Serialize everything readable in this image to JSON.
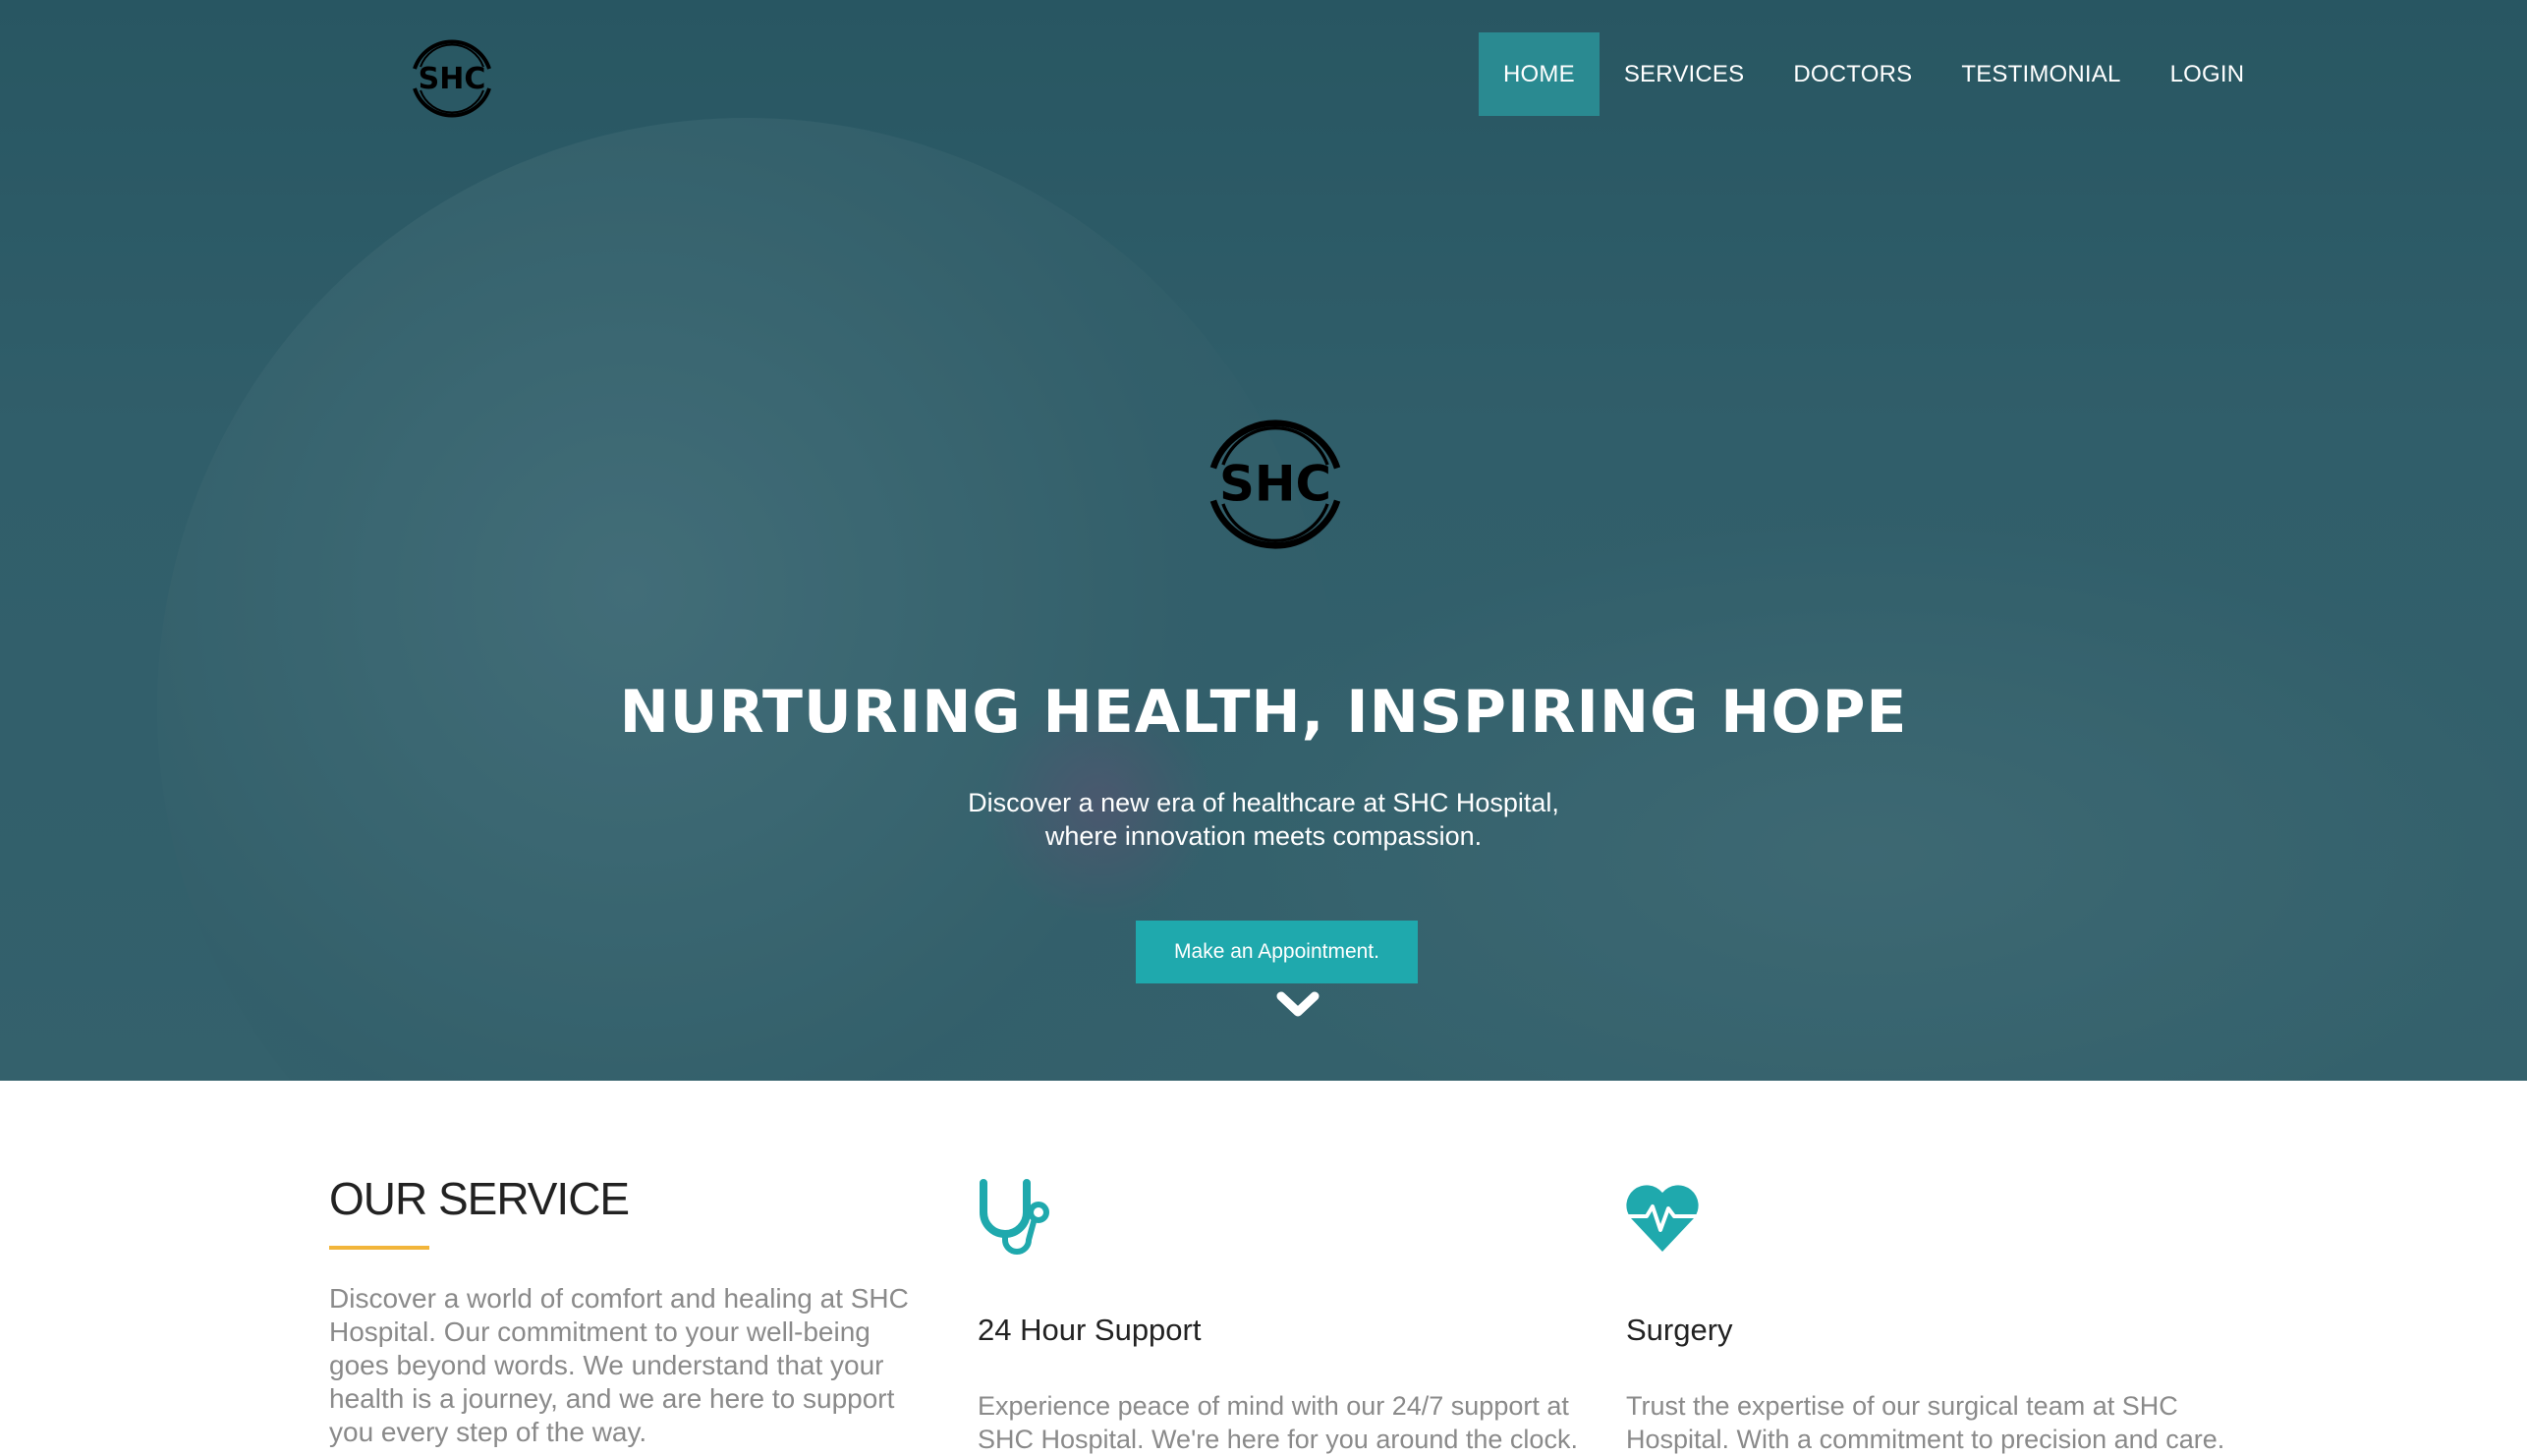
{
  "brand": {
    "logo_text": "SHC"
  },
  "nav": {
    "items": [
      {
        "label": "HOME",
        "active": true
      },
      {
        "label": "SERVICES",
        "active": false
      },
      {
        "label": "DOCTORS",
        "active": false
      },
      {
        "label": "TESTIMONIAL",
        "active": false
      },
      {
        "label": "LOGIN",
        "active": false
      }
    ]
  },
  "hero": {
    "logo_text": "SHC",
    "title": "NURTURING HEALTH, INSPIRING HOPE",
    "subtitle_line1": "Discover a new era of healthcare at SHC Hospital,",
    "subtitle_line2": "where innovation meets compassion.",
    "cta_label": "Make an Appointment.",
    "scroll_icon": "chevron-down-icon"
  },
  "services": {
    "heading": "OUR SERVICE",
    "intro": "Discover a world of comfort and healing at SHC Hospital. Our commitment to your well-being goes beyond words. We understand that your health is a journey, and we are here to support you every step of the way.",
    "cards": [
      {
        "icon": "stethoscope-icon",
        "title": "24 Hour Support",
        "text": "Experience peace of mind with our 24/7 support at SHC Hospital. We're here for you around the clock."
      },
      {
        "icon": "heartbeat-icon",
        "title": "Surgery",
        "text": "Trust the expertise of our surgical team at SHC Hospital. With a commitment to precision and care."
      }
    ]
  },
  "colors": {
    "accent": "#1fa9ad",
    "nav_active": "#2a8a91",
    "underline": "#f2b53a",
    "hero_overlay": "#2d5a66"
  }
}
